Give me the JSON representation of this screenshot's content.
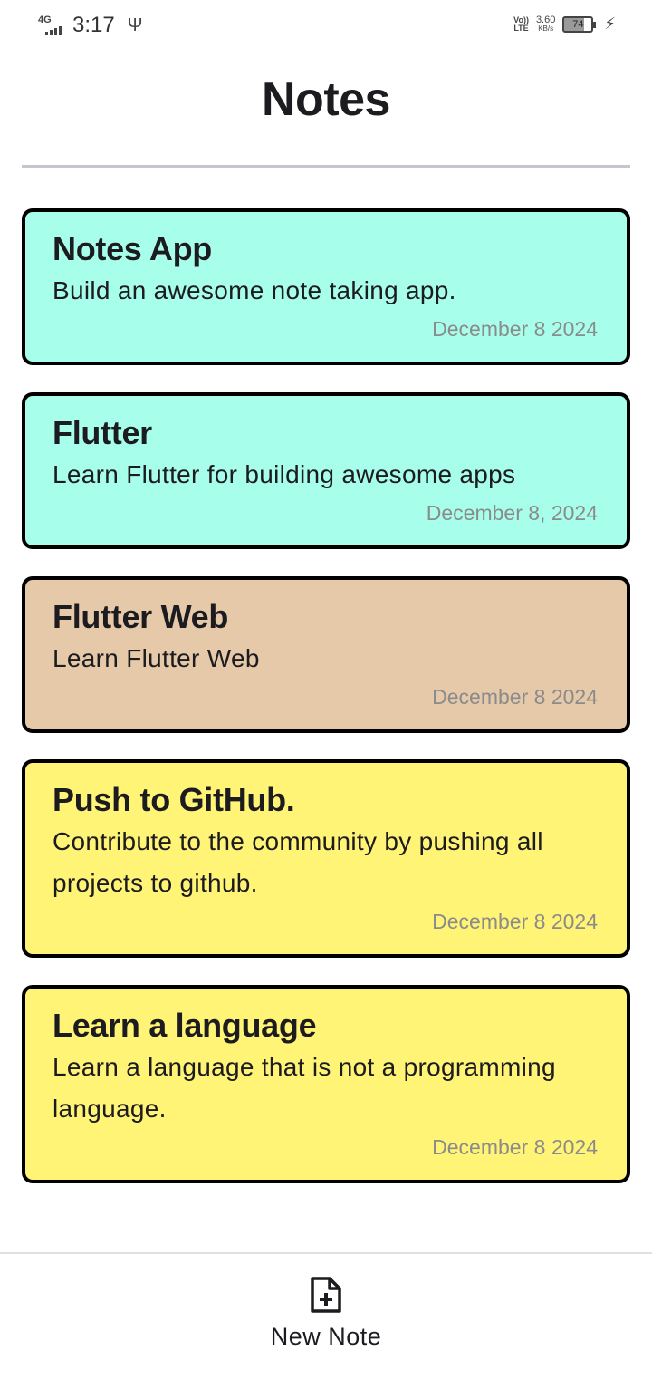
{
  "status_bar": {
    "network": "4G",
    "time": "3:17",
    "volte_top": "Vo))",
    "volte_bottom": "LTE",
    "speed_value": "3.60",
    "speed_unit": "KB/s",
    "battery": "74"
  },
  "header": {
    "title": "Notes"
  },
  "notes": [
    {
      "title": "Notes App",
      "body": "Build an awesome note taking app.",
      "date": "December 8 2024",
      "color": "#a7ffeb"
    },
    {
      "title": "Flutter",
      "body": "Learn Flutter for building awesome apps",
      "date": "December 8, 2024",
      "color": "#a7ffeb"
    },
    {
      "title": "Flutter Web",
      "body": "Learn Flutter Web",
      "date": "December 8 2024",
      "color": "#e6c9a8"
    },
    {
      "title": "Push to GitHub.",
      "body": "Contribute to the community by pushing all projects to github.",
      "date": "December 8 2024",
      "color": "#fff475"
    },
    {
      "title": "Learn a language",
      "body": "Learn a language that is not a programming language.",
      "date": "December 8 2024",
      "color": "#fff475"
    }
  ],
  "bottom_nav": {
    "new_note_label": "New Note",
    "new_note_icon": "note-add-icon"
  }
}
